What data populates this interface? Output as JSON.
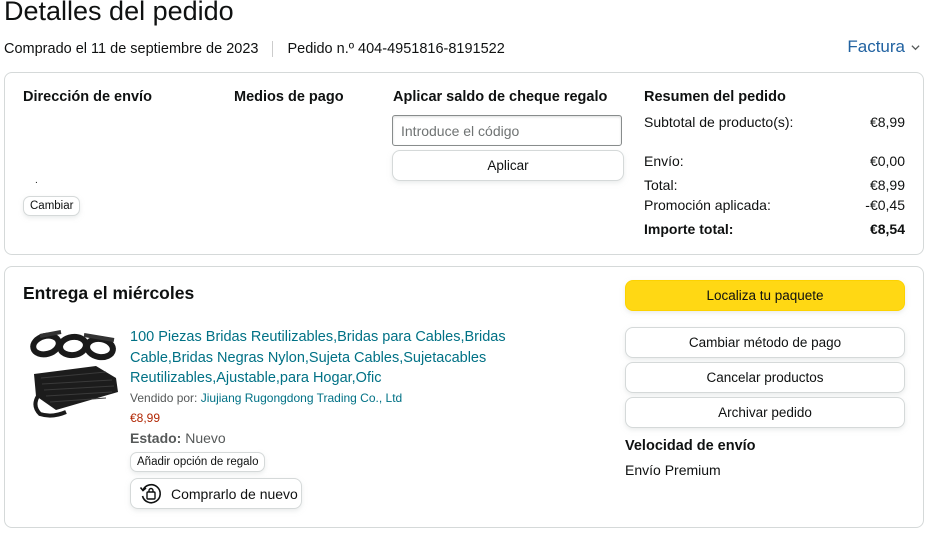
{
  "header": {
    "title": "Detalles del pedido",
    "purchased": "Comprado el 11 de septiembre de 2023",
    "order_number": "Pedido n.º 404-4951816-8191522",
    "invoice_link": "Factura"
  },
  "shipping_address": {
    "heading": "Dirección de envío",
    "dot": ".",
    "change_label": "Cambiar"
  },
  "payment": {
    "heading": "Medios de pago"
  },
  "gift_card": {
    "heading": "Aplicar saldo de cheque regalo",
    "placeholder": "Introduce el código",
    "apply_label": "Aplicar"
  },
  "summary": {
    "heading": "Resumen del pedido",
    "rows": [
      {
        "label": "Subtotal de producto(s):",
        "value": "€8,99"
      },
      {
        "label": "Envío:",
        "value": "€0,00"
      },
      {
        "label": "Total:",
        "value": "€8,99"
      },
      {
        "label": "Promoción aplicada:",
        "value": "-€0,45"
      },
      {
        "label": "Importe total:",
        "value": "€8,54"
      }
    ]
  },
  "delivery": {
    "heading": "Entrega el miércoles",
    "product": {
      "title": "100 Piezas Bridas Reutilizables,Bridas para Cables,Bridas Cable,Bridas Negras Nylon,Sujeta Cables,Sujetacables Reutilizables,Ajustable,para Hogar,Ofic",
      "sold_by_label": "Vendido por:",
      "seller": "Jiujiang Rugongdong Trading Co., Ltd",
      "price": "€8,99",
      "condition_label": "Estado:",
      "condition_value": "Nuevo",
      "gift_option_label": "Añadir opción de regalo",
      "buy_again_label": "Comprarlo de nuevo"
    },
    "actions": {
      "track": "Localiza tu paquete",
      "change_payment": "Cambiar método de pago",
      "cancel": "Cancelar productos",
      "archive": "Archivar pedido"
    },
    "shipping_speed": {
      "heading": "Velocidad de envío",
      "value": "Envío Premium"
    }
  },
  "colors": {
    "link": "#007185",
    "invoice_link": "#2162a1",
    "price": "#b12704",
    "primary_button": "#ffd814"
  }
}
